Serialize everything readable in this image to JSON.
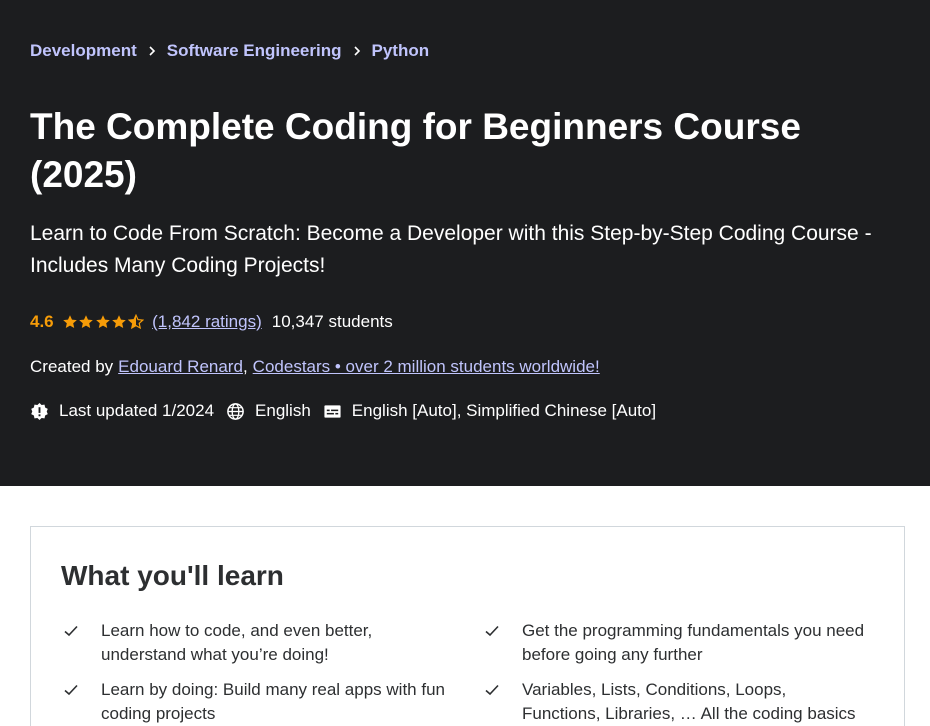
{
  "breadcrumb": [
    "Development",
    "Software Engineering",
    "Python"
  ],
  "course": {
    "title": "The Complete Coding for Beginners Course (2025)",
    "subtitle": "Learn to Code From Scratch: Become a Developer with this Step-by-Step Coding Course - Includes Many Coding Projects!",
    "rating": "4.6",
    "stars_filled": 4.5,
    "ratings_count_text": "(1,842 ratings)",
    "students_text": "10,347 students",
    "created_by_label": "Created by",
    "instructors": [
      "Edouard Renard",
      "Codestars • over 2 million students worldwide!"
    ],
    "instructor_separator": ",",
    "last_updated": "Last updated 1/2024",
    "language": "English",
    "captions": "English [Auto], Simplified Chinese [Auto]"
  },
  "learn": {
    "heading": "What you'll learn",
    "items": [
      "Learn how to code, and even better, understand what you’re doing!",
      "Get the programming fundamentals you need before going any further",
      "Learn by doing: Build many real apps with fun coding projects",
      "Variables, Lists, Conditions, Loops, Functions, Libraries, … All the coding basics"
    ]
  },
  "colors": {
    "hero_bg": "#1c1d1f",
    "link": "#c0c4fc",
    "rating": "#f69c08",
    "text_dark": "#2d2f31"
  },
  "icons": {
    "breadcrumb_separator": "chevron-right-icon",
    "star": "star-icon",
    "last_updated": "new-badge-icon",
    "language": "globe-icon",
    "captions": "closed-captions-icon",
    "learn_item": "check-icon"
  }
}
